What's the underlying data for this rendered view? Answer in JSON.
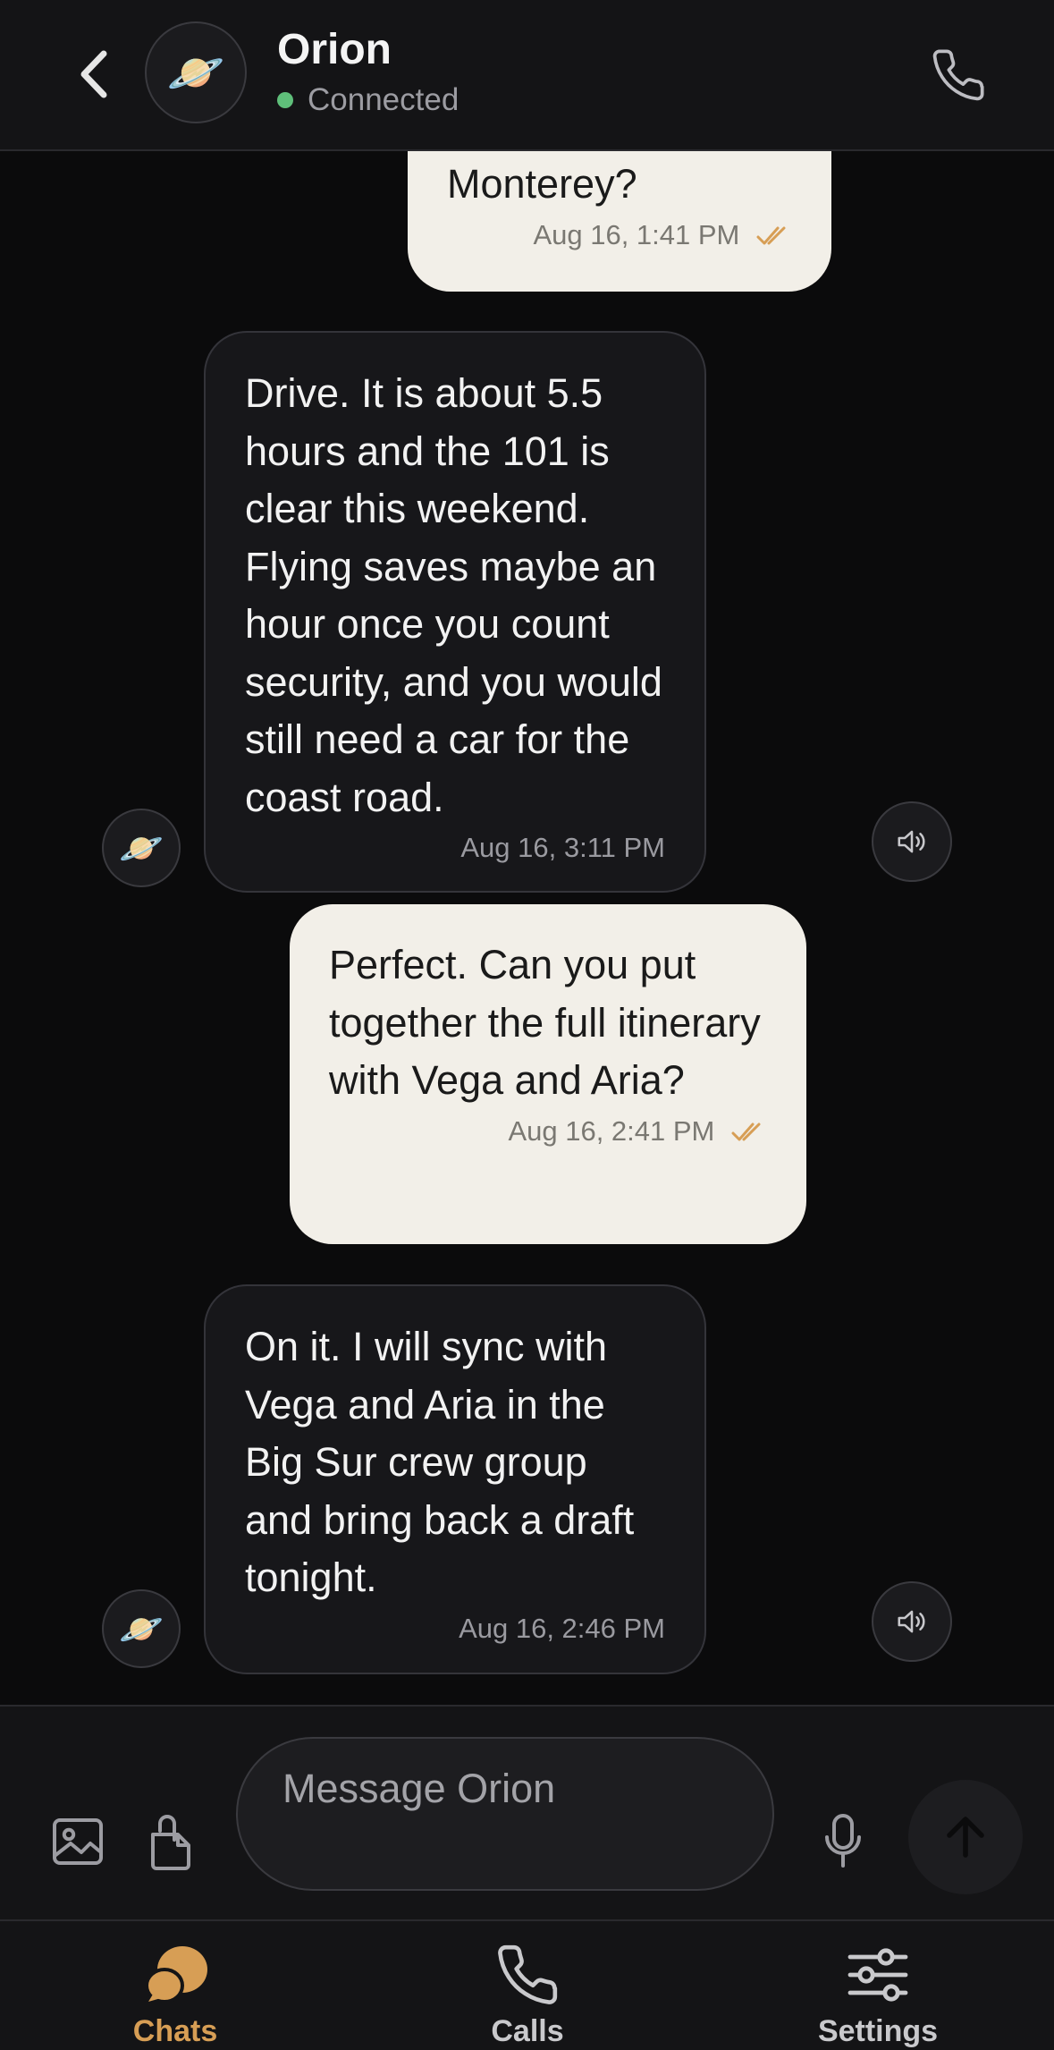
{
  "header": {
    "contact_name": "Orion",
    "status": "Connected",
    "avatar_emoji": "🪐",
    "status_color": "#5fbf7a"
  },
  "messages": [
    {
      "direction": "outgoing",
      "text": "Monterey?",
      "time": "Aug 16, 1:41 PM",
      "read": true
    },
    {
      "direction": "incoming",
      "text": "Drive. It is about 5.5 hours and the 101 is clear this weekend. Flying saves maybe an hour once you count security, and you would still need a car for the coast road.",
      "time": "Aug 16, 3:11 PM"
    },
    {
      "direction": "outgoing",
      "text": "Perfect. Can you put together the full itinerary with Vega and Aria?",
      "time": "Aug 16, 2:41 PM",
      "read": true
    },
    {
      "direction": "incoming",
      "text": "On it. I will sync with Vega and Aria in the Big Sur crew group and bring back a draft tonight.",
      "time": "Aug 16, 2:46 PM"
    }
  ],
  "composer": {
    "placeholder": "Message Orion",
    "value": ""
  },
  "tabs": [
    {
      "label": "Chats",
      "active": true,
      "icon": "chat-bubbles-icon"
    },
    {
      "label": "Calls",
      "active": false,
      "icon": "phone-icon"
    },
    {
      "label": "Settings",
      "active": false,
      "icon": "sliders-icon"
    }
  ],
  "colors": {
    "accent": "#d79e55",
    "outgoing_bubble": "#f2efe8",
    "incoming_bubble": "#17171a",
    "background": "#0b0b0c"
  }
}
